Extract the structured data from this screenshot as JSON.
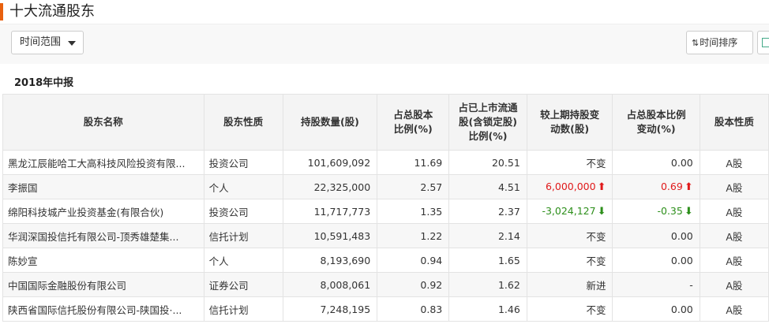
{
  "title": "十大流通股东",
  "toolbar": {
    "range_label": "时间范围",
    "sort_label": "时间排序",
    "sort_icon": "sort-arrows-icon",
    "export_icon": "excel-export-icon"
  },
  "period": "2018年中报",
  "table": {
    "headers": [
      "股东名称",
      "股东性质",
      "持股数量(股)",
      "占总股本比例(%)",
      "占已上市流通股(含锁定股)比例(%)",
      "较上期持股变动数(股)",
      "占总股本比例变动(%)",
      "股本性质"
    ],
    "rows": [
      {
        "name": "黑龙江辰能哈工大高科技风险投资有限...",
        "type": "投资公司",
        "shares": "101,609,092",
        "pct_total": "11.69",
        "pct_float": "20.51",
        "change": "不变",
        "change_dir": "none",
        "pct_change": "0.00",
        "pct_dir": "none",
        "share_type": "A股"
      },
      {
        "name": "李振国",
        "type": "个人",
        "shares": "22,325,000",
        "pct_total": "2.57",
        "pct_float": "4.51",
        "change": "6,000,000",
        "change_dir": "up",
        "pct_change": "0.69",
        "pct_dir": "up",
        "share_type": "A股"
      },
      {
        "name": "绵阳科技城产业投资基金(有限合伙)",
        "type": "投资公司",
        "shares": "11,717,773",
        "pct_total": "1.35",
        "pct_float": "2.37",
        "change": "-3,024,127",
        "change_dir": "down",
        "pct_change": "-0.35",
        "pct_dir": "down",
        "share_type": "A股"
      },
      {
        "name": "华润深国投信托有限公司-顶秀雄楚集...",
        "type": "信托计划",
        "shares": "10,591,483",
        "pct_total": "1.22",
        "pct_float": "2.14",
        "change": "不变",
        "change_dir": "none",
        "pct_change": "0.00",
        "pct_dir": "none",
        "share_type": "A股"
      },
      {
        "name": "陈妙宣",
        "type": "个人",
        "shares": "8,193,690",
        "pct_total": "0.94",
        "pct_float": "1.65",
        "change": "不变",
        "change_dir": "none",
        "pct_change": "0.00",
        "pct_dir": "none",
        "share_type": "A股"
      },
      {
        "name": "中国国际金融股份有限公司",
        "type": "证券公司",
        "shares": "8,008,061",
        "pct_total": "0.92",
        "pct_float": "1.62",
        "change": "新进",
        "change_dir": "none",
        "pct_change": "-",
        "pct_dir": "none",
        "share_type": "A股"
      },
      {
        "name": "陕西省国际信托股份有限公司-陕国投·...",
        "type": "信托计划",
        "shares": "7,248,195",
        "pct_total": "0.83",
        "pct_float": "1.46",
        "change": "不变",
        "change_dir": "none",
        "pct_change": "0.00",
        "pct_dir": "none",
        "share_type": "A股"
      }
    ]
  },
  "colors": {
    "accent": "#e8600e",
    "up": "#e0191a",
    "down": "#2d8f1b"
  }
}
